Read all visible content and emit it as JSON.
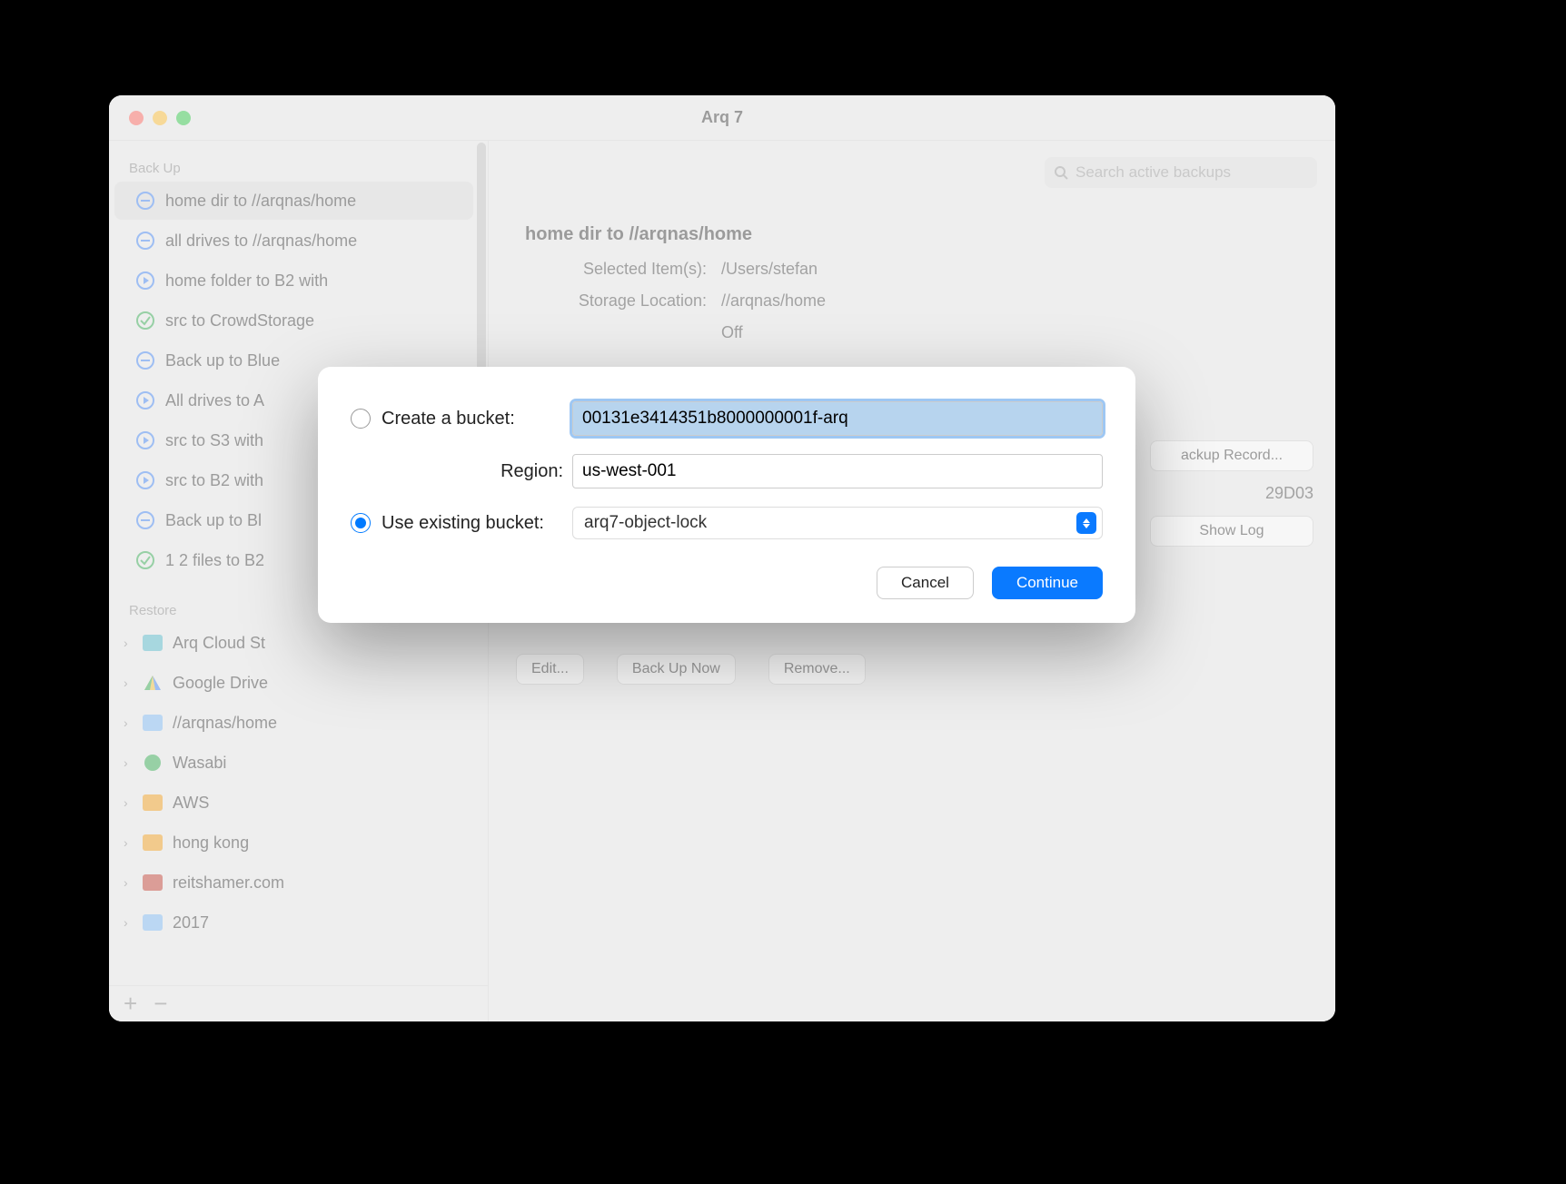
{
  "window": {
    "title": "Arq 7"
  },
  "sidebar": {
    "backup_header": "Back Up",
    "restore_header": "Restore",
    "backups": [
      {
        "label": "home dir to //arqnas/home",
        "icon": "minus-blue",
        "selected": true
      },
      {
        "label": "all drives to //arqnas/home",
        "icon": "minus-blue"
      },
      {
        "label": "home folder to B2 with",
        "icon": "play-blue"
      },
      {
        "label": "src to CrowdStorage",
        "icon": "check-green"
      },
      {
        "label": "Back up to Blue",
        "icon": "minus-blue"
      },
      {
        "label": "All drives to A",
        "icon": "play-blue"
      },
      {
        "label": "src to S3 with",
        "icon": "play-blue"
      },
      {
        "label": "src to B2 with",
        "icon": "play-blue"
      },
      {
        "label": "Back up to Bl",
        "icon": "minus-blue"
      },
      {
        "label": "1 2 files to B2",
        "icon": "check-green"
      }
    ],
    "restores": [
      {
        "label": "Arq Cloud St",
        "color": "#4fb8c9"
      },
      {
        "label": "Google Drive",
        "color": "#f1c232"
      },
      {
        "label": "//arqnas/home",
        "color": "#7ab8f5"
      },
      {
        "label": "Wasabi",
        "color": "#2aa84a"
      },
      {
        "label": "AWS",
        "color": "#f39c12"
      },
      {
        "label": "hong kong",
        "color": "#f39c12"
      },
      {
        "label": "reitshamer.com",
        "color": "#c0392b"
      },
      {
        "label": "2017",
        "color": "#7ab8f5"
      }
    ],
    "footer": {
      "add": "+",
      "remove": "−"
    }
  },
  "search": {
    "placeholder": "Search active backups"
  },
  "detail": {
    "title": "home dir to //arqnas/home",
    "rows": {
      "selected_label": "Selected Item(s):",
      "selected_value": "/Users/stefan",
      "storage_label": "Storage Location:",
      "storage_value": "//arqnas/home"
    },
    "partial_encryption_off": "Off",
    "partial_code": "29D03",
    "backup_record_btn": "ackup Record...",
    "show_log_btn": "Show Log",
    "edit_btn": "Edit...",
    "backup_now_btn": "Back Up Now",
    "remove_btn": "Remove..."
  },
  "modal": {
    "create_label": "Create a bucket:",
    "create_value": "00131e3414351b8000000001f-arq",
    "region_label": "Region:",
    "region_value": "us-west-001",
    "existing_label": "Use existing bucket:",
    "existing_value": "arq7-object-lock",
    "cancel": "Cancel",
    "continue": "Continue"
  }
}
